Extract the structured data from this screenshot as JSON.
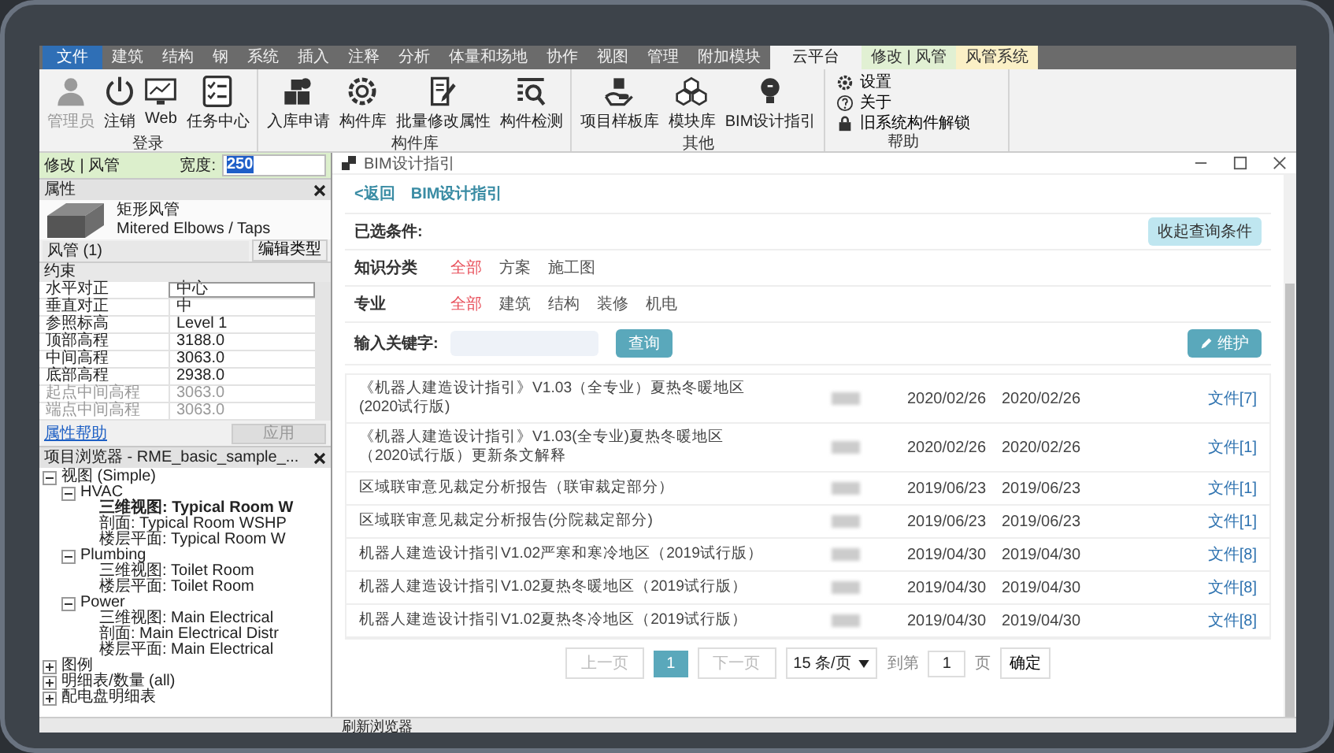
{
  "ribbon": {
    "tabs": [
      {
        "label": "文件",
        "selected": false,
        "kind": "file"
      },
      {
        "label": "建筑",
        "selected": false,
        "kind": "plain"
      },
      {
        "label": "结构",
        "selected": false,
        "kind": "plain"
      },
      {
        "label": "钢",
        "selected": false,
        "kind": "plain"
      },
      {
        "label": "系统",
        "selected": false,
        "kind": "plain"
      },
      {
        "label": "插入",
        "selected": false,
        "kind": "plain"
      },
      {
        "label": "注释",
        "selected": false,
        "kind": "plain"
      },
      {
        "label": "分析",
        "selected": false,
        "kind": "plain"
      },
      {
        "label": "体量和场地",
        "selected": false,
        "kind": "plain"
      },
      {
        "label": "协作",
        "selected": false,
        "kind": "plain"
      },
      {
        "label": "视图",
        "selected": false,
        "kind": "plain"
      },
      {
        "label": "管理",
        "selected": false,
        "kind": "plain"
      },
      {
        "label": "附加模块",
        "selected": false,
        "kind": "plain"
      },
      {
        "label": "云平台",
        "selected": true,
        "kind": "plain"
      },
      {
        "label": "修改 | 风管",
        "selected": false,
        "kind": "context-modify"
      },
      {
        "label": "风管系统",
        "selected": false,
        "kind": "context-system"
      }
    ],
    "groups": [
      {
        "title": "登录",
        "buttons": [
          {
            "label": "管理员",
            "disabled": true
          },
          {
            "label": "注销",
            "disabled": false
          },
          {
            "label": "Web",
            "disabled": false
          },
          {
            "label": "任务中心",
            "disabled": false
          }
        ]
      },
      {
        "title": "构件库",
        "buttons": [
          {
            "label": "入库申请",
            "disabled": false
          },
          {
            "label": "构件库",
            "disabled": false
          },
          {
            "label": "批量修改属性",
            "disabled": false
          },
          {
            "label": "构件检测",
            "disabled": false
          }
        ]
      },
      {
        "title": "其他",
        "buttons": [
          {
            "label": "项目样板库",
            "disabled": false
          },
          {
            "label": "模块库",
            "disabled": false
          },
          {
            "label": "BIM设计指引",
            "disabled": false
          }
        ]
      }
    ],
    "help": {
      "title": "帮助",
      "items": [
        "设置",
        "关于",
        "旧系统构件解锁"
      ]
    }
  },
  "options_bar": {
    "label": "修改 | 风管",
    "field_label": "宽度:",
    "value": "250"
  },
  "properties": {
    "title": "属性",
    "family": "矩形风管",
    "type": "Mitered Elbows / Taps",
    "selector": "风管 (1)",
    "edit_type": "编辑类型",
    "section": "约束",
    "rows": [
      {
        "name": "水平对正",
        "value": "中心",
        "disabled": false
      },
      {
        "name": "垂直对正",
        "value": "中",
        "disabled": false
      },
      {
        "name": "参照标高",
        "value": "Level 1",
        "disabled": false
      },
      {
        "name": "顶部高程",
        "value": "3188.0",
        "disabled": false
      },
      {
        "name": "中间高程",
        "value": "3063.0",
        "disabled": false
      },
      {
        "name": "底部高程",
        "value": "2938.0",
        "disabled": false
      },
      {
        "name": "起点中间高程",
        "value": "3063.0",
        "disabled": true
      },
      {
        "name": "端点中间高程",
        "value": "3063.0",
        "disabled": true
      }
    ],
    "help_link": "属性帮助",
    "apply": {
      "label": "应用",
      "disabled": true
    }
  },
  "browser": {
    "title": "项目浏览器 - RME_basic_sample_...",
    "tree": [
      {
        "label": "视图 (Simple)",
        "expanded": true,
        "selected": false,
        "children": [
          {
            "label": "HVAC",
            "expanded": true,
            "selected": false,
            "children": [
              {
                "label": "三维视图: Typical Room W",
                "selected": true
              },
              {
                "label": "剖面: Typical Room WSHP",
                "selected": false
              },
              {
                "label": "楼层平面: Typical Room W",
                "selected": false
              }
            ]
          },
          {
            "label": "Plumbing",
            "expanded": true,
            "selected": false,
            "children": [
              {
                "label": "三维视图: Toilet Room",
                "selected": false
              },
              {
                "label": "楼层平面: Toilet Room",
                "selected": false
              }
            ]
          },
          {
            "label": "Power",
            "expanded": true,
            "selected": false,
            "children": [
              {
                "label": "三维视图: Main Electrical",
                "selected": false
              },
              {
                "label": "剖面: Main Electrical Distr",
                "selected": false
              },
              {
                "label": "楼层平面: Main Electrical",
                "selected": false
              }
            ]
          }
        ]
      },
      {
        "label": "图例",
        "expanded": false,
        "selected": false
      },
      {
        "label": "明细表/数量 (all)",
        "expanded": false,
        "selected": false
      },
      {
        "label": "配电盘明细表",
        "expanded": false,
        "selected": false
      }
    ]
  },
  "status_bar": "刷新浏览器",
  "dialog": {
    "title": "BIM设计指引",
    "back": "<返回",
    "heading": "BIM设计指引",
    "conditions_label": "已选条件:",
    "collapse_button": "收起查询条件",
    "filters": [
      {
        "label": "知识分类",
        "options": [
          {
            "label": "全部",
            "selected": true
          },
          {
            "label": "方案",
            "selected": false
          },
          {
            "label": "施工图",
            "selected": false
          }
        ]
      },
      {
        "label": "专业",
        "options": [
          {
            "label": "全部",
            "selected": true
          },
          {
            "label": "建筑",
            "selected": false
          },
          {
            "label": "结构",
            "selected": false
          },
          {
            "label": "装修",
            "selected": false
          },
          {
            "label": "机电",
            "selected": false
          }
        ]
      }
    ],
    "keyword_label": "输入关键字:",
    "search_button": "查询",
    "maintain_button": "维护",
    "rows": [
      {
        "title": [
          "《机器人建造设计指引》V1.03（全专业）夏热冬暖地区",
          "(2020试行版)"
        ],
        "created": "2020/02/26",
        "updated": "2020/02/26",
        "files": "文件[7]"
      },
      {
        "title": [
          "《机器人建造设计指引》V1.03(全专业)夏热冬暖地区",
          "（2020试行版）更新条文解释"
        ],
        "created": "2020/02/26",
        "updated": "2020/02/26",
        "files": "文件[1]"
      },
      {
        "title": [
          "区域联审意见裁定分析报告（联审裁定部分）"
        ],
        "created": "2019/06/23",
        "updated": "2019/06/23",
        "files": "文件[1]"
      },
      {
        "title": [
          "区域联审意见裁定分析报告(分院裁定部分)"
        ],
        "created": "2019/06/23",
        "updated": "2019/06/23",
        "files": "文件[1]"
      },
      {
        "title": [
          "机器人建造设计指引V1.02严寒和寒冷地区（2019试行版）"
        ],
        "created": "2019/04/30",
        "updated": "2019/04/30",
        "files": "文件[8]"
      },
      {
        "title": [
          "机器人建造设计指引V1.02夏热冬暖地区（2019试行版）"
        ],
        "created": "2019/04/30",
        "updated": "2019/04/30",
        "files": "文件[8]"
      },
      {
        "title": [
          "机器人建造设计指引V1.02夏热冬冷地区（2019试行版）"
        ],
        "created": "2019/04/30",
        "updated": "2019/04/30",
        "files": "文件[8]"
      }
    ],
    "pagination": {
      "prev": {
        "label": "上一页",
        "disabled": true
      },
      "pages": [
        {
          "label": "1",
          "selected": true
        }
      ],
      "next": {
        "label": "下一页",
        "disabled": true
      },
      "page_size": "15 条/页",
      "goto_label": "到第",
      "goto_value": "1",
      "page_unit": "页",
      "confirm": "确定"
    }
  }
}
